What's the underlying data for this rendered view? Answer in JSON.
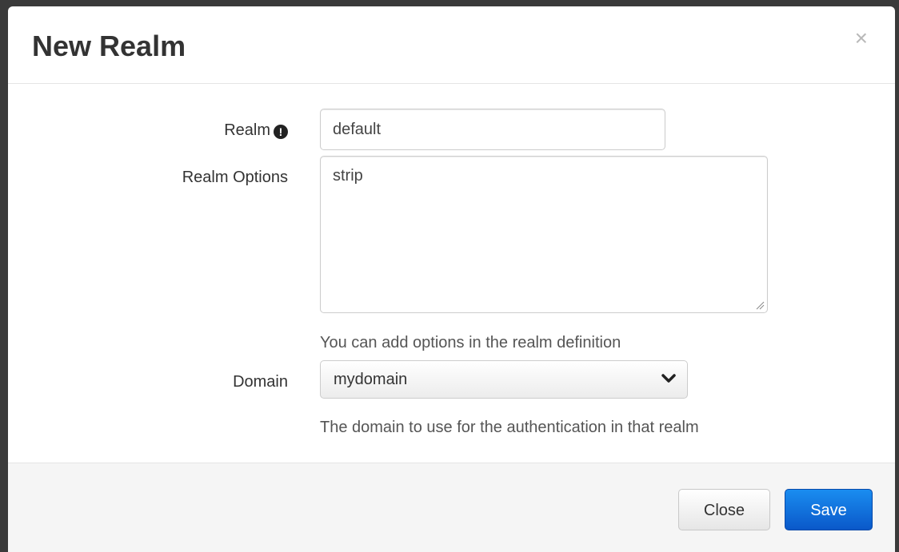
{
  "dialog": {
    "title": "New Realm",
    "close_glyph": "×"
  },
  "form": {
    "realm": {
      "label": "Realm",
      "info_icon": "exclamation-circle-icon",
      "value": "default"
    },
    "realm_options": {
      "label": "Realm Options",
      "value": "strip",
      "help": "You can add options in the realm definition"
    },
    "domain": {
      "label": "Domain",
      "selected": "mydomain",
      "help": "The domain to use for the authentication in that realm"
    }
  },
  "footer": {
    "close_label": "Close",
    "save_label": "Save"
  },
  "colors": {
    "primary": "#0a6ddc",
    "text": "#333333",
    "muted": "#555555",
    "footer_bg": "#f5f5f5"
  }
}
